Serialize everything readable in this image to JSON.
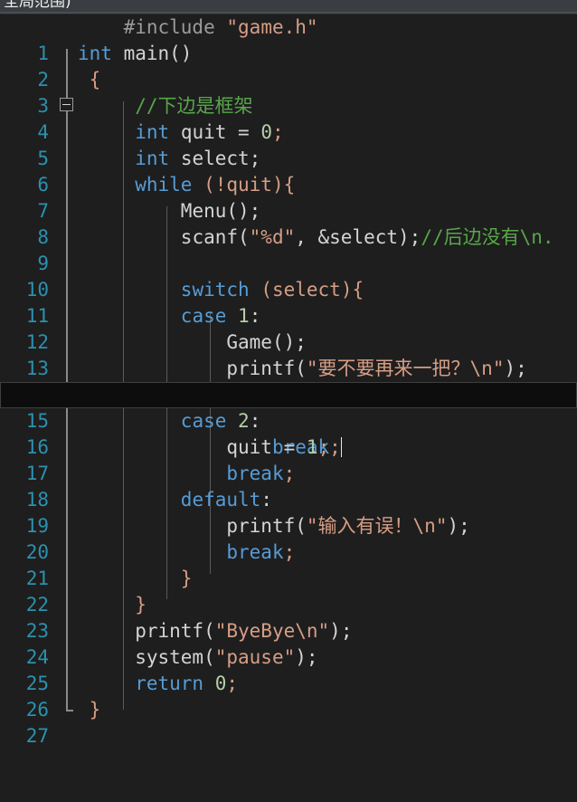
{
  "window": {
    "scope_bar_text": "全局范围)"
  },
  "editor": {
    "language": "c",
    "current_line": 15,
    "colors": {
      "background": "#1e1e1e",
      "current_line_background": "#0d0d0d",
      "line_number": "#2b91af",
      "keyword": "#569cd6",
      "string": "#d69d85",
      "comment": "#57a64a",
      "number": "#b5cea8",
      "identifier": "#d4d4d4",
      "preprocessor": "#9b9b9b",
      "scope_bar": "#3a3d41"
    },
    "line_numbers": [
      1,
      2,
      3,
      4,
      5,
      6,
      7,
      8,
      9,
      10,
      11,
      12,
      13,
      14,
      15,
      16,
      17,
      18,
      19,
      20,
      21,
      22,
      23,
      24,
      25,
      26,
      27
    ],
    "lines": [
      {
        "n": 1,
        "text": "    #include \"game.h\""
      },
      {
        "n": 2,
        "text": "int main()"
      },
      {
        "n": 3,
        "text": " {"
      },
      {
        "n": 4,
        "text": "     //下边是框架"
      },
      {
        "n": 5,
        "text": "     int quit = 0;"
      },
      {
        "n": 6,
        "text": "     int select;"
      },
      {
        "n": 7,
        "text": "     while (!quit){"
      },
      {
        "n": 8,
        "text": "         Menu();"
      },
      {
        "n": 9,
        "text": "         scanf(\"%d\", &select);//后边没有\\n."
      },
      {
        "n": 10,
        "text": ""
      },
      {
        "n": 11,
        "text": "         switch (select){"
      },
      {
        "n": 12,
        "text": "         case 1:"
      },
      {
        "n": 13,
        "text": "             Game();"
      },
      {
        "n": 14,
        "text": "             printf(\"要不要再来一把？\\n\");"
      },
      {
        "n": 15,
        "text": "             break;"
      },
      {
        "n": 16,
        "text": "         case 2:"
      },
      {
        "n": 17,
        "text": "             quit = 1;"
      },
      {
        "n": 18,
        "text": "             break;"
      },
      {
        "n": 19,
        "text": "         default:"
      },
      {
        "n": 20,
        "text": "             printf(\"输入有误！\\n\");"
      },
      {
        "n": 21,
        "text": "             break;"
      },
      {
        "n": 22,
        "text": "         }"
      },
      {
        "n": 23,
        "text": "     }"
      },
      {
        "n": 24,
        "text": "     printf(\"ByeBye\\n\");"
      },
      {
        "n": 25,
        "text": "     system(\"pause\");"
      },
      {
        "n": 26,
        "text": "     return 0;"
      },
      {
        "n": 27,
        "text": " }"
      }
    ],
    "tokens": {
      "l1_include": "#include",
      "l1_header": "\"game.h\"",
      "l2_kw": "int",
      "l2_fn": "main()",
      "l3_brace": "{",
      "l4_comment": "//下边是框架",
      "l5_kw": "int",
      "l5_id": "quit",
      "l5_op": "=",
      "l5_num": "0",
      "l5_semi": ";",
      "l6_kw": "int",
      "l6_id": "select;",
      "l7_kw": "while",
      "l7_rest": "(!quit){",
      "l8_call": "Menu();",
      "l9_fn": "scanf(",
      "l9_str": "\"%d\"",
      "l9_args": ", &select);",
      "l9_comment": "//后边没有\\n.",
      "l11_kw": "switch",
      "l11_rest": "(select){",
      "l12_kw": "case",
      "l12_num": "1",
      "l12_colon": ":",
      "l13_call": "Game();",
      "l14_fn": "printf(",
      "l14_str": "\"要不要再来一把？\\n\"",
      "l14_tail": ");",
      "l15_kw": "break",
      "l15_semi": ";",
      "l16_kw": "case",
      "l16_num": "2",
      "l16_colon": ":",
      "l17_id": "quit",
      "l17_op": "=",
      "l17_num": "1",
      "l17_semi": ";",
      "l18_kw": "break",
      "l18_semi": ";",
      "l19_kw": "default",
      "l19_colon": ":",
      "l20_fn": "printf(",
      "l20_str": "\"输入有误！\\n\"",
      "l20_tail": ");",
      "l21_kw": "break",
      "l21_semi": ";",
      "l22_brace": "}",
      "l23_brace": "}",
      "l24_fn": "printf(",
      "l24_str": "\"ByeBye\\n\"",
      "l24_tail": ");",
      "l25_fn": "system(",
      "l25_str": "\"pause\"",
      "l25_tail": ");",
      "l26_kw": "return",
      "l26_num": "0",
      "l26_semi": ";",
      "l27_brace": "}"
    }
  }
}
